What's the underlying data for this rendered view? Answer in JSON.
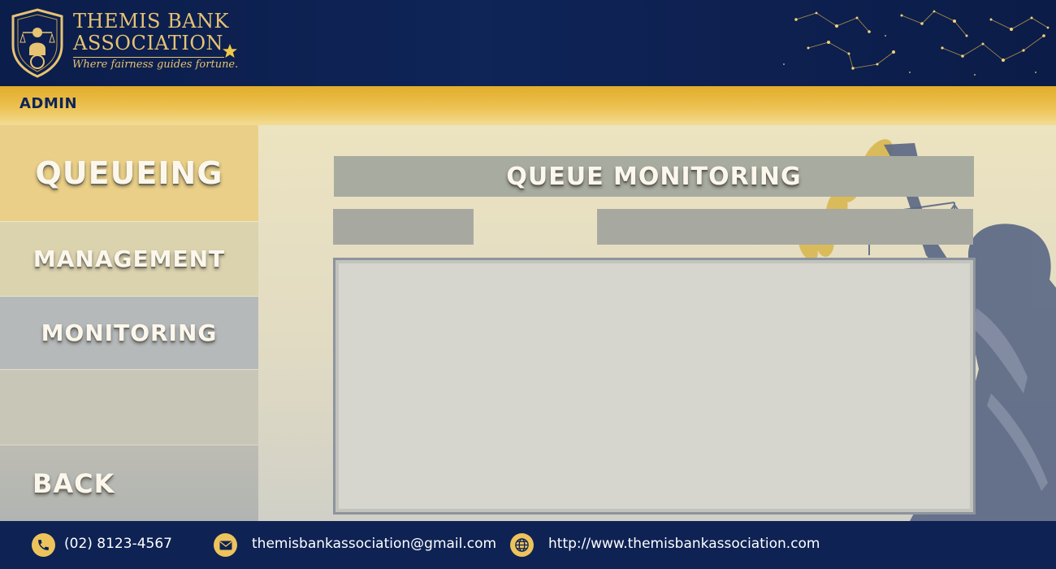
{
  "brand": {
    "line1": "THEMIS BANK",
    "line2": "ASSOCIATION",
    "tagline": "Where fairness guides fortune."
  },
  "admin_bar": {
    "label": "ADMIN"
  },
  "sidebar": {
    "items": [
      {
        "label": "QUEUEING",
        "state": "active"
      },
      {
        "label": "MANAGEMENT"
      },
      {
        "label": "MONITORING",
        "state": "selected"
      },
      {
        "label": ""
      },
      {
        "label": "BACK"
      }
    ]
  },
  "main": {
    "title": "QUEUE MONITORING",
    "field_left_value": "",
    "field_right_value": ""
  },
  "footer": {
    "phone": "(02) 8123-4567",
    "email": "themisbankassociation@gmail.com",
    "website": "http://www.themisbankassociation.com"
  },
  "icons": {
    "logo": "themis-shield-logo",
    "star": "star-icon",
    "phone": "phone-icon",
    "email": "mail-icon",
    "web": "globe-icon"
  },
  "colors": {
    "navy": "#0e2254",
    "gold": "#e6c373",
    "admin_bar": "#e2ad2a",
    "queueing_bg": "#e9cf87",
    "monitoring_bg": "#b5b9b9"
  }
}
